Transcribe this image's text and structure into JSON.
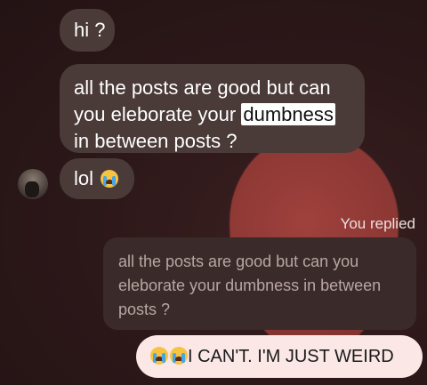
{
  "messages": {
    "incoming": [
      {
        "text": "hi ?"
      },
      {
        "text_before": "all the posts are good but can you eleborate your ",
        "highlight": "dumbness",
        "text_after": " in between posts ?"
      },
      {
        "text": "lol",
        "emoji": "crying-face"
      }
    ],
    "reply_status": "You replied",
    "quoted": "all the posts are good but can you eleborate your dumbness in between posts ?",
    "outgoing": {
      "emoji": [
        "crying-face",
        "crying-face"
      ],
      "text": "I CAN'T.  I'M JUST WEIRD"
    }
  }
}
